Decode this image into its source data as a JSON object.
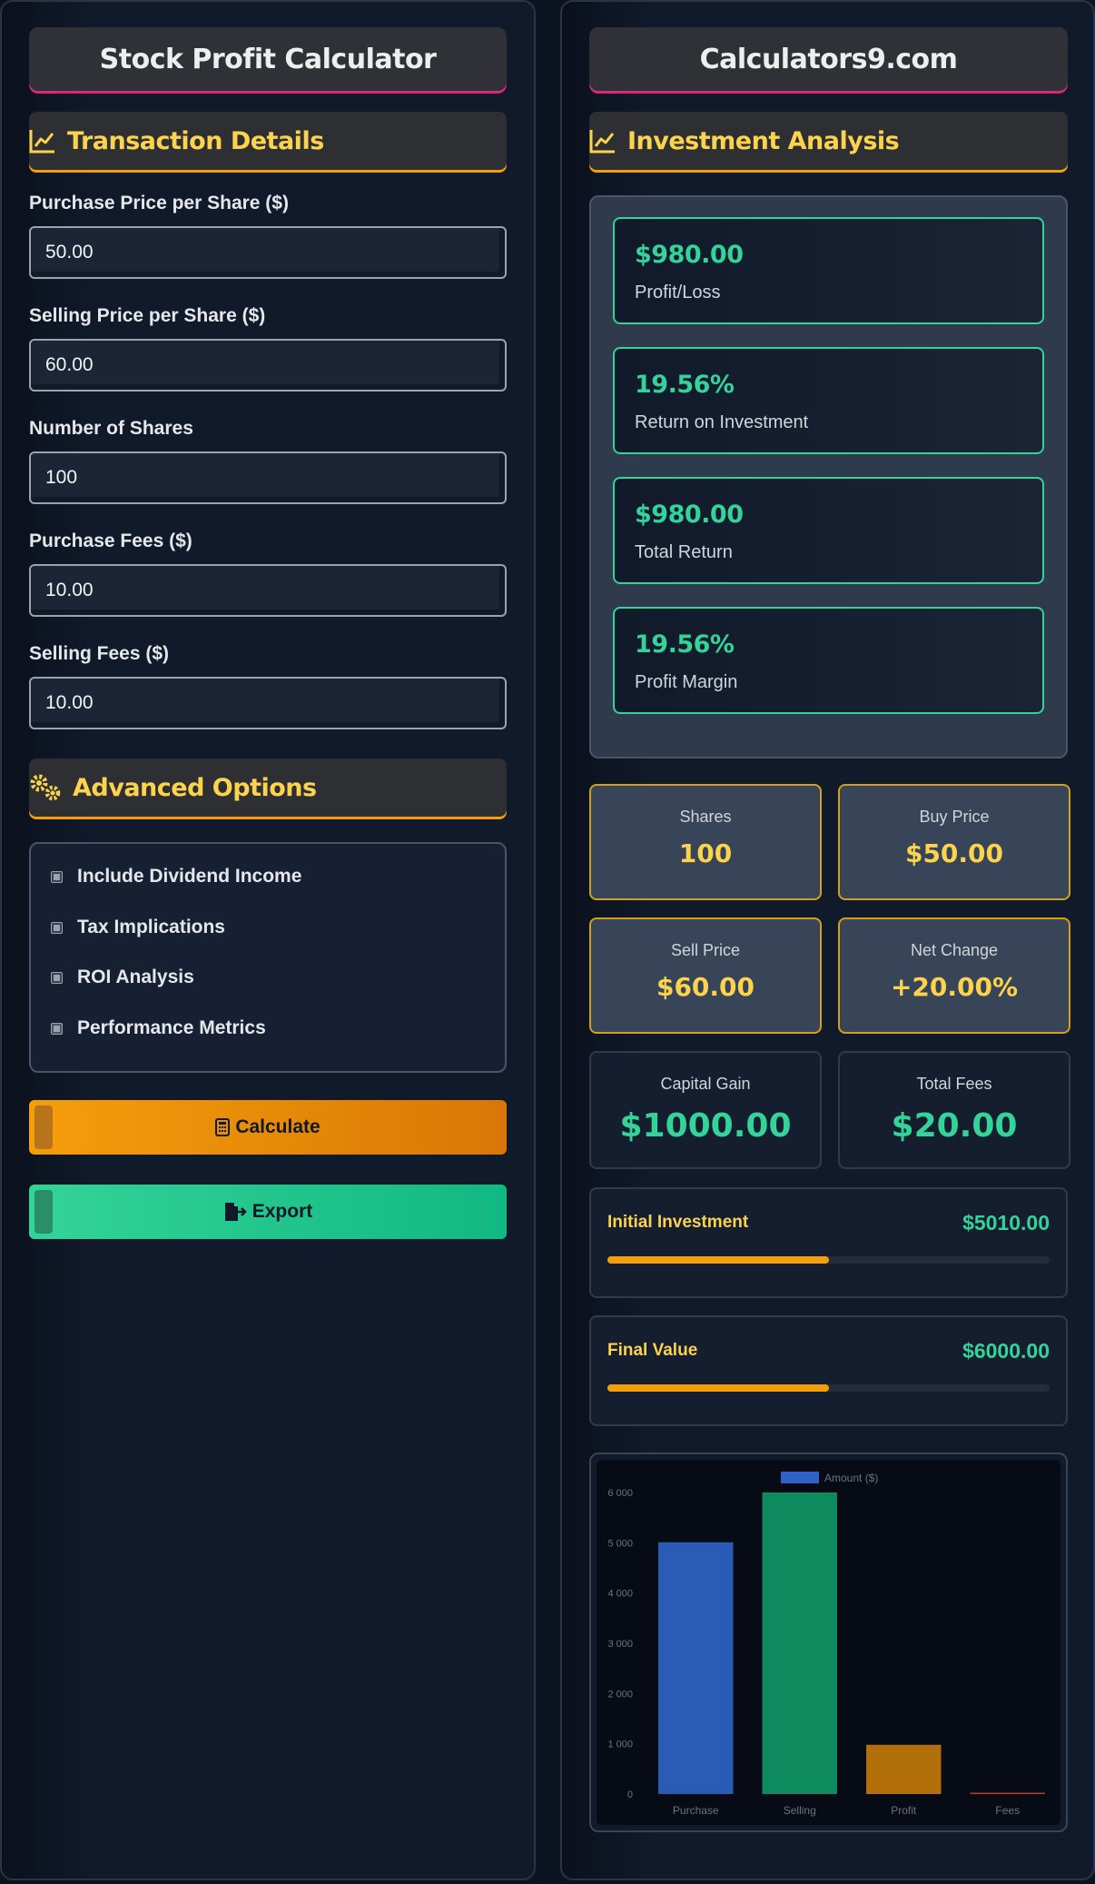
{
  "left": {
    "title": "Stock Profit Calculator",
    "section_transaction": "Transaction Details",
    "fields": [
      {
        "label": "Purchase Price per Share ($)",
        "value": "50.00"
      },
      {
        "label": "Selling Price per Share ($)",
        "value": "60.00"
      },
      {
        "label": "Number of Shares",
        "value": "100"
      },
      {
        "label": "Purchase Fees ($)",
        "value": "10.00"
      },
      {
        "label": "Selling Fees ($)",
        "value": "10.00"
      }
    ],
    "section_advanced": "Advanced Options",
    "options": [
      {
        "label": "Include Dividend Income",
        "checked": false
      },
      {
        "label": "Tax Implications",
        "checked": false
      },
      {
        "label": "ROI Analysis",
        "checked": false
      },
      {
        "label": "Performance Metrics",
        "checked": true
      }
    ],
    "calculate_label": "Calculate",
    "export_label": "Export"
  },
  "right": {
    "title": "Calculators9.com",
    "section_analysis": "Investment Analysis",
    "results": [
      {
        "value": "$980.00",
        "caption": "Profit/Loss"
      },
      {
        "value": "19.56%",
        "caption": "Return on Investment"
      },
      {
        "value": "$980.00",
        "caption": "Total Return"
      },
      {
        "value": "19.56%",
        "caption": "Profit Margin"
      }
    ],
    "stats": [
      {
        "caption": "Shares",
        "value": "100"
      },
      {
        "caption": "Buy Price",
        "value": "$50.00"
      },
      {
        "caption": "Sell Price",
        "value": "$60.00"
      },
      {
        "caption": "Net Change",
        "value": "+20.00%"
      }
    ],
    "totals": [
      {
        "caption": "Capital Gain",
        "value": "$1000.00"
      },
      {
        "caption": "Total Fees",
        "value": "$20.00"
      }
    ],
    "progress": [
      {
        "label": "Initial Investment",
        "value": "$5010.00",
        "fill_percent": 50
      },
      {
        "label": "Final Value",
        "value": "$6000.00",
        "fill_percent": 50
      }
    ]
  },
  "colors": {
    "accent_orange": "#f59e0b",
    "accent_green": "#34d399",
    "heading_yellow": "#fcd34d",
    "title_underline": "#db2777"
  },
  "icons": {
    "transaction": "chart-line-icon",
    "analysis": "chart-line-icon",
    "advanced": "gears-icon",
    "calculate": "calculator-icon",
    "export": "file-export-icon"
  },
  "chart_data": {
    "type": "bar",
    "categories": [
      "Purchase",
      "Selling",
      "Profit",
      "Fees"
    ],
    "series": [
      {
        "name": "Amount ($)",
        "values": [
          5010,
          6000,
          980,
          20
        ],
        "colors": [
          "#2a5bb5",
          "#0d8a5e",
          "#b26f0a",
          "#c0392b"
        ]
      }
    ],
    "legend": "Amount ($)",
    "legend_color": "#2f62c9",
    "legend_position": "top",
    "yticks": [
      "0",
      "1 000",
      "2 000",
      "3 000",
      "4 000",
      "5 000",
      "6 000"
    ],
    "ylim": [
      0,
      6000
    ],
    "grid": false
  }
}
